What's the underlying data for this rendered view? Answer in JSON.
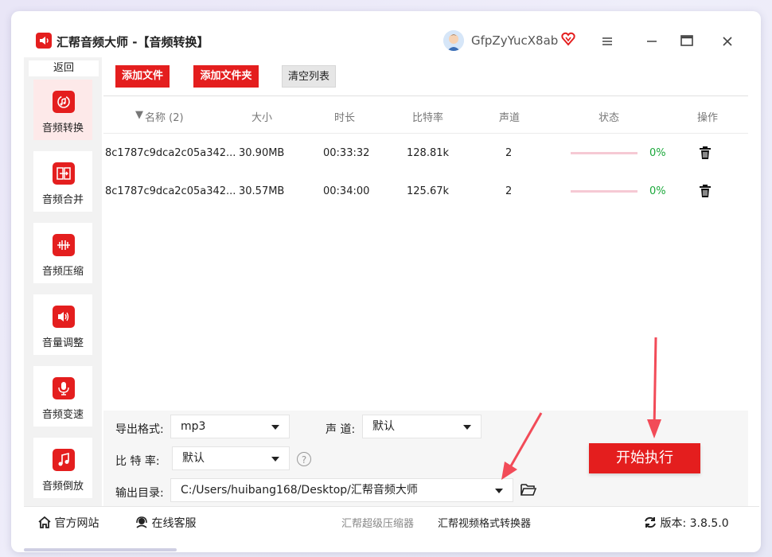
{
  "titlebar": {
    "app_title": "汇帮音频大师 -【音频转换】",
    "user_name": "GfpZyYucX8ab"
  },
  "sidebar": {
    "back_label": "返回",
    "items": [
      {
        "label": "音频转换",
        "icon": "audio-convert-icon",
        "active": true
      },
      {
        "label": "音频合并",
        "icon": "audio-merge-icon"
      },
      {
        "label": "音频压缩",
        "icon": "audio-compress-icon"
      },
      {
        "label": "音量调整",
        "icon": "volume-icon"
      },
      {
        "label": "音频变速",
        "icon": "microphone-icon"
      },
      {
        "label": "音频倒放",
        "icon": "music-note-icon"
      }
    ]
  },
  "toolbar": {
    "add_file": "添加文件",
    "add_folder": "添加文件夹",
    "clear_list": "清空列表"
  },
  "table": {
    "headers": {
      "name": "名称 (2)",
      "size": "大小",
      "duration": "时长",
      "bitrate": "比特率",
      "channels": "声道",
      "status": "状态",
      "action": "操作"
    },
    "rows": [
      {
        "name": "8c1787c9dca2c05a342...",
        "size": "30.90MB",
        "duration": "00:33:32",
        "bitrate": "128.81k",
        "channels": "2",
        "progress": "0%"
      },
      {
        "name": "8c1787c9dca2c05a342...",
        "size": "30.57MB",
        "duration": "00:34:00",
        "bitrate": "125.67k",
        "channels": "2",
        "progress": "0%"
      }
    ]
  },
  "settings": {
    "format_label": "导出格式:",
    "format_value": "mp3",
    "channel_label": "声 道:",
    "channel_value": "默认",
    "bitrate_label": "比 特 率:",
    "bitrate_value": "默认",
    "output_label": "输出目录:",
    "output_value": "C:/Users/huibang168/Desktop/汇帮音频大师",
    "help": "?",
    "start_button": "开始执行"
  },
  "footer": {
    "website": "官方网站",
    "support": "在线客服",
    "link1": "汇帮超级压缩器",
    "link2": "汇帮视频格式转换器",
    "version": "版本: 3.8.5.0"
  },
  "colors": {
    "accent": "#e41e1e",
    "progress_text": "#1aa83a",
    "progress_track": "#f6c9d4"
  }
}
